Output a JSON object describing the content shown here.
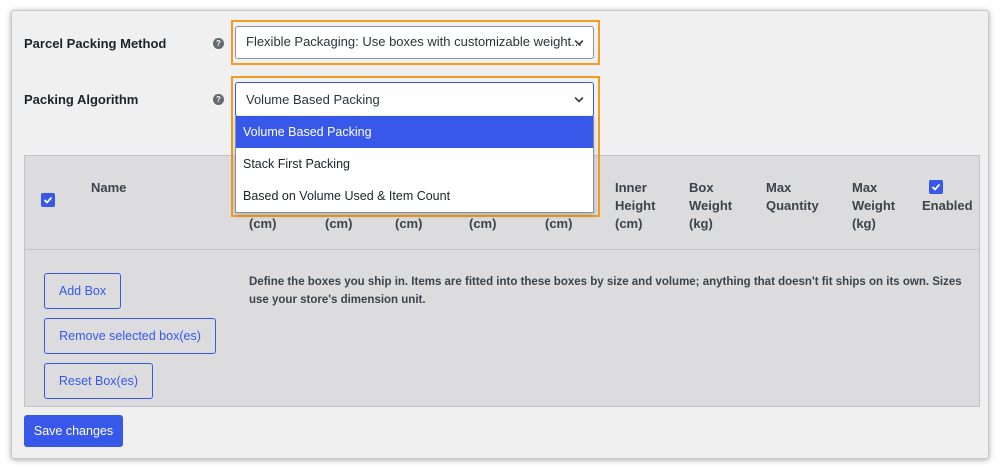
{
  "settings": {
    "packing_method": {
      "label": "Parcel Packing Method",
      "value": "Flexible Packaging: Use boxes with customizable weight..."
    },
    "packing_algorithm": {
      "label": "Packing Algorithm",
      "value": "Volume Based Packing",
      "options": [
        "Volume Based Packing",
        "Stack First Packing",
        "Based on Volume Used & Item Count"
      ]
    },
    "help_glyph": "?"
  },
  "table": {
    "headers": {
      "name": "Name",
      "col2": "(cm)",
      "col3": "(cm)",
      "col4": "(cm)",
      "col5": "(cm)",
      "col6": "(cm)",
      "inner_height": [
        "Inner",
        "Height",
        "(cm)"
      ],
      "box_weight": [
        "Box",
        "Weight",
        "(kg)"
      ],
      "max_quantity": [
        "Max",
        "Quantity"
      ],
      "max_weight": [
        "Max",
        "Weight",
        "(kg)"
      ],
      "enabled": "Enabled"
    },
    "buttons": {
      "add": "Add Box",
      "remove": "Remove selected box(es)",
      "reset": "Reset Box(es)"
    },
    "description": "Define the boxes you ship in. Items are fitted into these boxes by size and volume; anything that doesn't fit ships on its own. Sizes use your store's dimension unit."
  },
  "save_label": "Save changes",
  "colors": {
    "accent": "#3858e9",
    "highlight": "#f39c1f"
  }
}
